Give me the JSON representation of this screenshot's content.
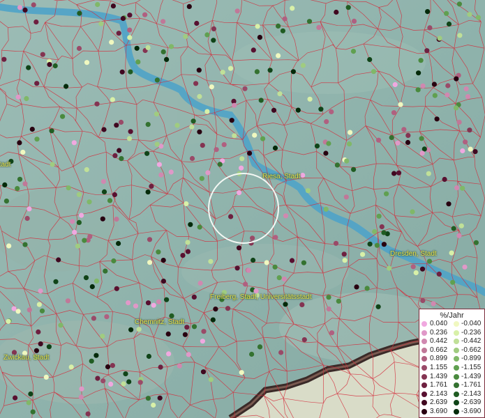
{
  "map": {
    "colors": {
      "terrain": "#8fb3ac",
      "river": "#4fa3c8",
      "boundaries": "#d42a3a"
    },
    "places": [
      {
        "name": "Riesa, Stadt",
        "icon": "town-label"
      },
      {
        "name": "Dresden, Stadt",
        "icon": "town-label"
      },
      {
        "name": "Freiberg, Stadt, Universitätsstadt",
        "icon": "town-label"
      },
      {
        "name": "Chemnitz, Stadt",
        "icon": "town-label"
      },
      {
        "name": "Zwickau, Stadt",
        "icon": "town-label"
      },
      {
        "name": "Stadt",
        "icon": "town-label"
      }
    ],
    "highlight": {
      "icon": "selection-circle"
    }
  },
  "legend": {
    "title": "%/Jahr",
    "positive": [
      {
        "label": "0.040",
        "color": "#f0a8e0"
      },
      {
        "label": "0.236",
        "color": "#e098c8"
      },
      {
        "label": "0.442",
        "color": "#d088b0"
      },
      {
        "label": "0.662",
        "color": "#c07898"
      },
      {
        "label": "0.899",
        "color": "#b06080"
      },
      {
        "label": "1.155",
        "color": "#9a4a68"
      },
      {
        "label": "1.439",
        "color": "#843452"
      },
      {
        "label": "1.761",
        "color": "#6e2040"
      },
      {
        "label": "2.143",
        "color": "#581030"
      },
      {
        "label": "2.639",
        "color": "#400820"
      },
      {
        "label": "3.690",
        "color": "#280010"
      }
    ],
    "negative": [
      {
        "label": "-0.040",
        "color": "#f0f8c0"
      },
      {
        "label": "-0.236",
        "color": "#d8f0a8"
      },
      {
        "label": "-0.442",
        "color": "#c0e098"
      },
      {
        "label": "-0.662",
        "color": "#a0cc80"
      },
      {
        "label": "-0.899",
        "color": "#80b868"
      },
      {
        "label": "-1.155",
        "color": "#60a050"
      },
      {
        "label": "-1.439",
        "color": "#4a8a3e"
      },
      {
        "label": "-1.761",
        "color": "#347230"
      },
      {
        "label": "-2.143",
        "color": "#205c22"
      },
      {
        "label": "-2.639",
        "color": "#104418"
      },
      {
        "label": "-3.690",
        "color": "#042a0a"
      }
    ]
  }
}
